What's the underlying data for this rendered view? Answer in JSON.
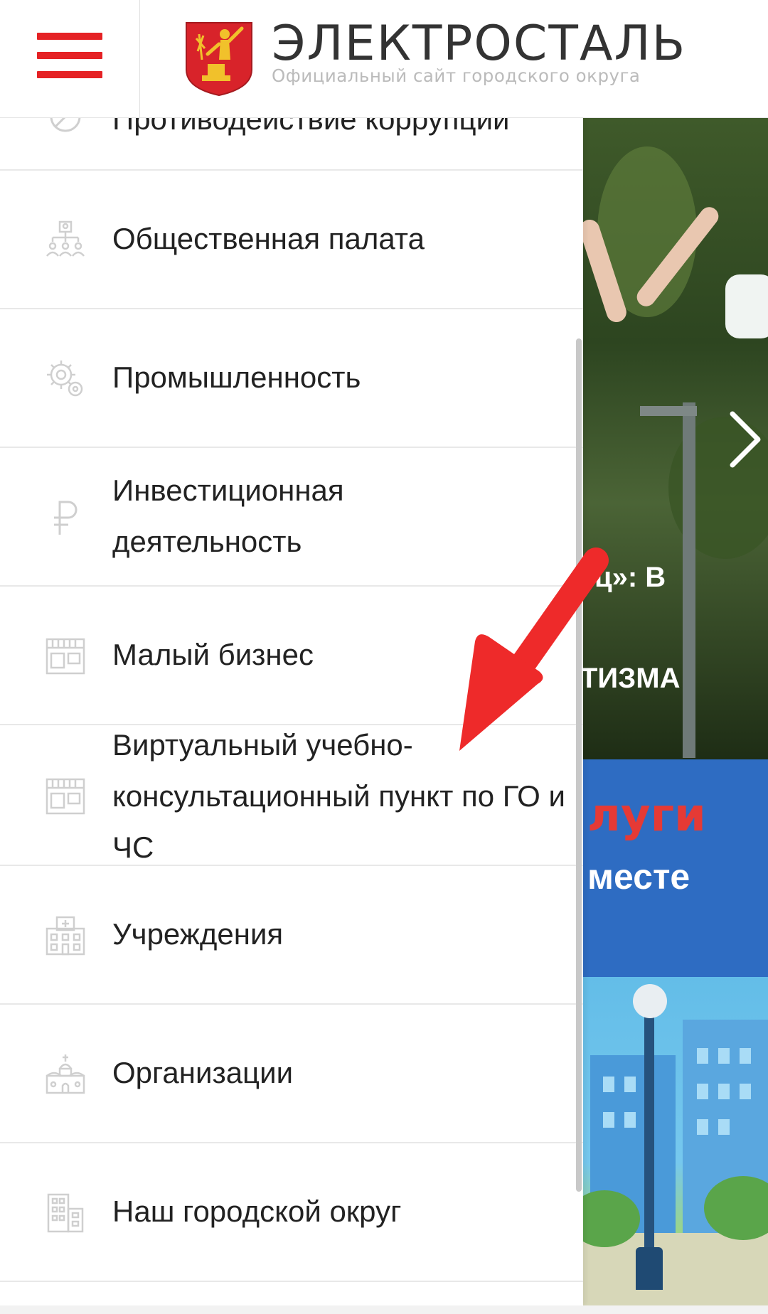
{
  "header": {
    "site_title": "ЭЛЕКТРОСТАЛЬ",
    "site_subtitle": "Официальный сайт городского округа",
    "menu_icon": "hamburger-icon",
    "logo_icon": "city-crest-icon",
    "accent_color": "#e52225"
  },
  "drawer": {
    "items": [
      {
        "label": "Противодействие коррупции",
        "icon": "prohibited-icon"
      },
      {
        "label": "Общественная палата",
        "icon": "hierarchy-icon"
      },
      {
        "label": "Промышленность",
        "icon": "gears-icon"
      },
      {
        "label": "Инвестиционная деятельность",
        "icon": "ruble-icon"
      },
      {
        "label": "Малый бизнес",
        "icon": "shop-icon"
      },
      {
        "label": "Виртуальный учебно-консультационный пункт по ГО и ЧС",
        "icon": "shop-icon"
      },
      {
        "label": "Учреждения",
        "icon": "hospital-icon"
      },
      {
        "label": "Организации",
        "icon": "church-icon"
      },
      {
        "label": "Наш городской округ",
        "icon": "buildings-icon"
      }
    ]
  },
  "background": {
    "slide_text_line1": "ц»: В",
    "slide_text_line2": "ТИЗМА",
    "banner_line1": "луги",
    "banner_line2": "месте",
    "next_icon": "chevron-right-icon"
  },
  "annotation": {
    "arrow_color": "#ee2a2a",
    "arrow_icon": "red-arrow-icon"
  }
}
